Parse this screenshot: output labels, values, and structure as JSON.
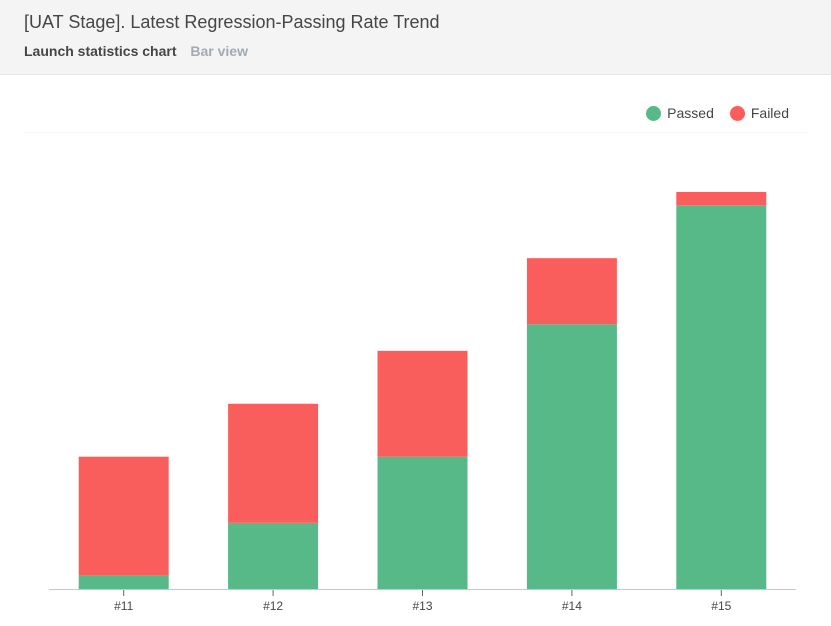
{
  "header": {
    "title": "[UAT Stage]. Latest Regression-Passing Rate Trend",
    "widget_type": "Launch statistics chart",
    "view_mode": "Bar view"
  },
  "legend": [
    {
      "label": "Passed",
      "color": "#56b987"
    },
    {
      "label": "Failed",
      "color": "#f95e5d"
    }
  ],
  "chart_data": {
    "type": "bar",
    "stacked": true,
    "title": "[UAT Stage]. Latest Regression-Passing Rate Trend",
    "xlabel": "",
    "ylabel": "",
    "categories": [
      "#11",
      "#12",
      "#13",
      "#14",
      "#15"
    ],
    "series": [
      {
        "name": "Passed",
        "color": "#56b987",
        "values": [
          1,
          5,
          10,
          20,
          29
        ]
      },
      {
        "name": "Failed",
        "color": "#f95e5d",
        "values": [
          9,
          9,
          8,
          5,
          1
        ]
      }
    ],
    "ylim": [
      0,
      30
    ],
    "grid": false,
    "legend_position": "top-right"
  }
}
